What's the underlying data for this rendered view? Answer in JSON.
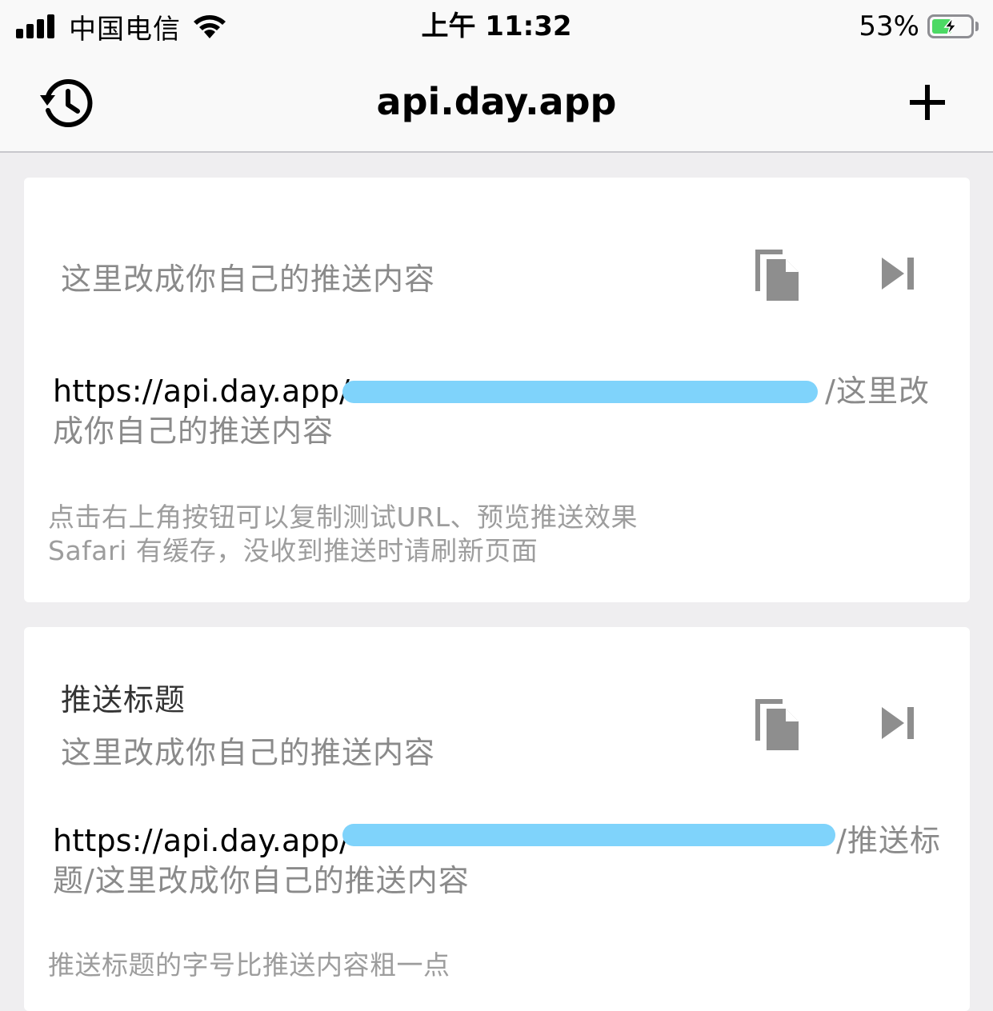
{
  "status_bar": {
    "carrier": "中国电信",
    "time": "上午 11:32",
    "battery_percent": "53%",
    "battery_level": 0.53,
    "signal_bars": 4
  },
  "nav": {
    "title": "api.day.app",
    "left_icon": "history-icon",
    "right_icon": "plus-icon"
  },
  "cards": [
    {
      "title": "",
      "body": "这里改成你自己的推送内容",
      "url_prefix": "https://api.day.app/",
      "url_key_redacted": "",
      "url_suffix": "/这里改成你自己的推送内容",
      "hint_lines": [
        "点击右上角按钮可以复制测试URL、预览推送效果",
        "Safari 有缓存，没收到推送时请刷新页面"
      ],
      "copy_icon": "copy-icon",
      "preview_icon": "skip-next-icon"
    },
    {
      "title": "推送标题",
      "body": "这里改成你自己的推送内容",
      "url_prefix": "https://api.day.app/",
      "url_key_redacted": "",
      "url_suffix": "/推送标题/这里改成你自己的推送内容",
      "hint_lines": [
        "推送标题的字号比推送内容粗一点"
      ],
      "copy_icon": "copy-icon",
      "preview_icon": "skip-next-icon"
    }
  ],
  "colors": {
    "background": "#efeef0",
    "card": "#ffffff",
    "redaction": "#7fd3fb",
    "icon_gray": "#8e8e8e",
    "battery_green": "#4cd964"
  }
}
